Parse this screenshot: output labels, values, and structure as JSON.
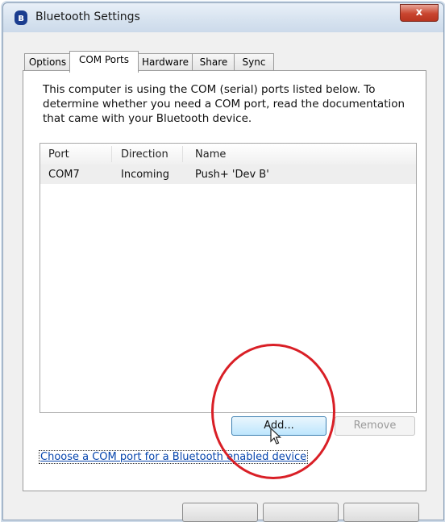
{
  "window": {
    "title": "Bluetooth Settings",
    "close_label": "x"
  },
  "tabs": [
    {
      "label": "Options"
    },
    {
      "label": "COM Ports"
    },
    {
      "label": "Hardware"
    },
    {
      "label": "Share"
    },
    {
      "label": "Sync"
    }
  ],
  "active_tab": "COM Ports",
  "description": "This computer is using the COM (serial) ports listed below. To determine whether you need a COM port, read the documentation that came with your Bluetooth device.",
  "ports_list": {
    "columns": [
      "Port",
      "Direction",
      "Name"
    ],
    "rows": [
      {
        "port": "COM7",
        "direction": "Incoming",
        "name": "Push+ 'Dev B'"
      }
    ]
  },
  "buttons": {
    "add": "Add...",
    "remove": "Remove"
  },
  "link_text": "Choose a COM port for a Bluetooth enabled device",
  "colors": {
    "highlight_circle": "#d91f26",
    "link": "#0645ad"
  }
}
